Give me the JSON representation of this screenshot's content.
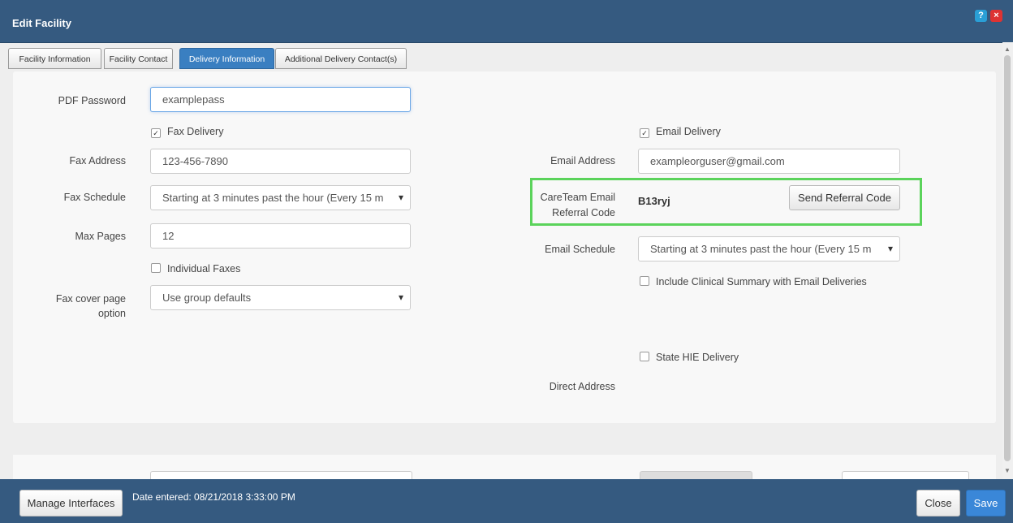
{
  "window": {
    "title": "Edit Facility",
    "help_icon": "?",
    "close_icon": "×"
  },
  "tabs": [
    "Facility Information",
    "Facility Contact",
    "Delivery Information",
    "Additional Delivery Contact(s)"
  ],
  "left": {
    "pdf_password_label": "PDF Password",
    "pdf_password_value": "examplepass",
    "fax_delivery": "Fax Delivery",
    "fax_address_label": "Fax Address",
    "fax_address_value": "123-456-7890",
    "fax_schedule_label": "Fax Schedule",
    "fax_schedule_value": "Starting at 3 minutes past the hour (Every 15 m",
    "max_pages_label": "Max Pages",
    "max_pages_value": "12",
    "individual_faxes": "Individual Faxes",
    "fax_cover_label": "Fax cover page",
    "fax_cover_label2": "option",
    "fax_cover_value": "Use group defaults"
  },
  "right": {
    "email_delivery": "Email Delivery",
    "email_address_label": "Email Address",
    "email_address_value": "exampleorguser@gmail.com",
    "careteam_label": "CareTeam Email",
    "careteam_label2": "Referral Code",
    "careteam_code": "B13ryj",
    "send_referral_button": "Send Referral Code",
    "email_schedule_label": "Email Schedule",
    "email_schedule_value": "Starting at 3 minutes past the hour (Every 15 m",
    "include_clinical": "Include Clinical Summary with Email Deliveries",
    "state_hie": "State HIE Delivery",
    "direct_address_label": "Direct Address"
  },
  "footer": {
    "manage_button": "Manage Interfaces",
    "date_entered": "Date entered: 08/21/2018 3:33:00 PM",
    "close_button": "Close",
    "save_button": "Save"
  },
  "checks": {
    "fax_delivery": true,
    "email_delivery": true,
    "individual_faxes": false,
    "include_clinical": false,
    "state_hie": false
  },
  "colors": {
    "header": "#355a80",
    "active_tab": "#3a7fc1",
    "highlight": "#5bd35b",
    "save": "#3a87d8"
  }
}
